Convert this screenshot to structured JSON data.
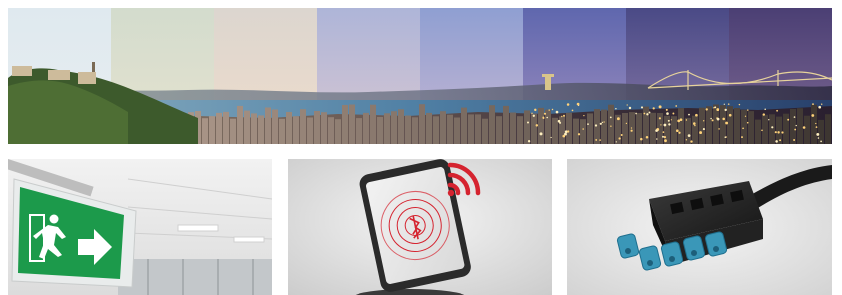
{
  "panorama": {
    "name": "lisbon-day-to-night-panorama",
    "segments": [
      {
        "sky_top": "#dfe9ef",
        "sky_bottom": "#e8eef0",
        "water": "#8fb3c4"
      },
      {
        "sky_top": "#d3dccd",
        "sky_bottom": "#e6e2cf",
        "water": "#7ea5b8"
      },
      {
        "sky_top": "#dcd6cf",
        "sky_bottom": "#efdccb",
        "water": "#6f97b0"
      },
      {
        "sky_top": "#aeb5d8",
        "sky_bottom": "#d8c7d2",
        "water": "#4f7fa4"
      },
      {
        "sky_top": "#8f9fd2",
        "sky_bottom": "#c7b7d3",
        "water": "#3d6f9e"
      },
      {
        "sky_top": "#5f67ae",
        "sky_bottom": "#9f8fbf",
        "water": "#2c5b8f"
      },
      {
        "sky_top": "#4a4a86",
        "sky_bottom": "#8a7aa8",
        "water": "#2a4c7c"
      },
      {
        "sky_top": "#4b3f74",
        "sky_bottom": "#7f6a94",
        "water": "#283f6a"
      }
    ]
  },
  "tiles": [
    {
      "name": "emergency-exit-sign-photo",
      "sign_color": "#1c9a4b"
    },
    {
      "name": "smartphone-bluetooth-photo",
      "accent": "#d5232f"
    },
    {
      "name": "wieland-connector-photo",
      "connector": "#2a2a2a",
      "pins": "#3a97b8"
    }
  ]
}
